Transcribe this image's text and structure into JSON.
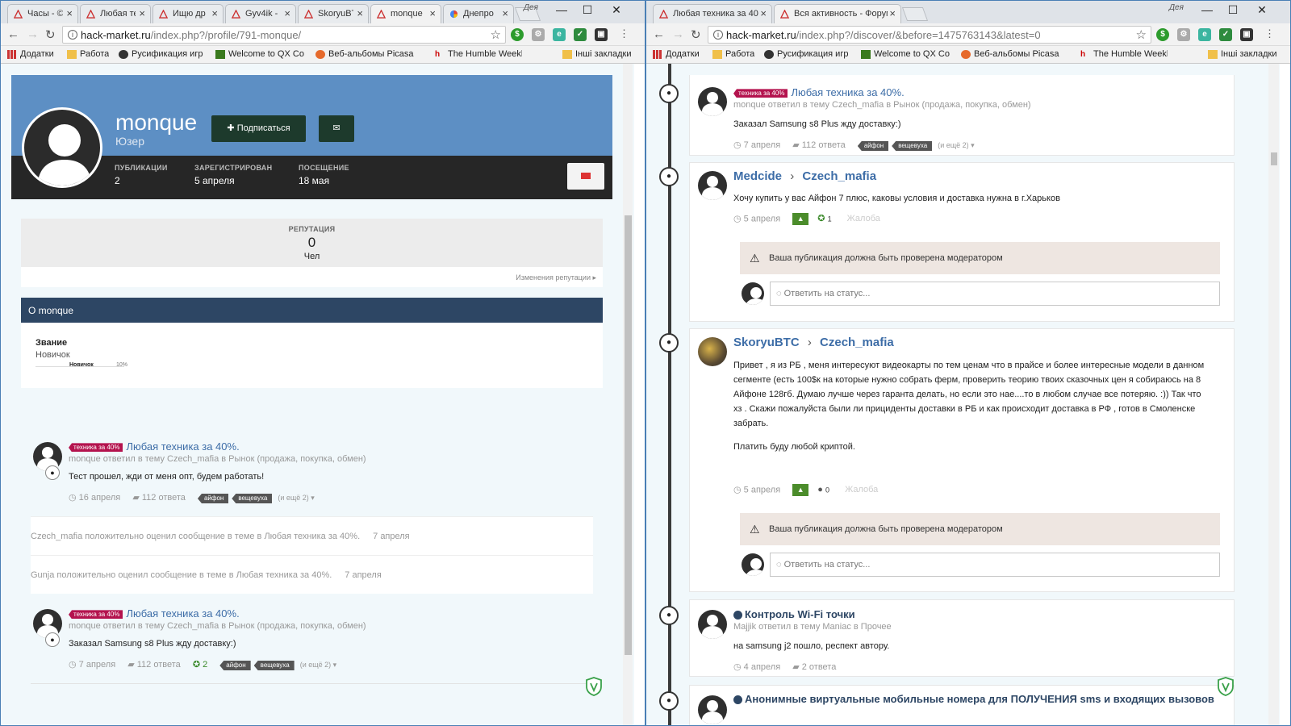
{
  "left": {
    "tabs": [
      {
        "label": "Часы - ©"
      },
      {
        "label": "Любая те"
      },
      {
        "label": "Ищю др"
      },
      {
        "label": "Gyv4ik -"
      },
      {
        "label": "SkoryuBT"
      },
      {
        "label": "monque"
      },
      {
        "label": "Днепро"
      }
    ],
    "profile_name": "Дея",
    "url_host": "hack-market.ru",
    "url_path": "/index.php?/profile/791-monque/",
    "bookmarks": [
      "Додатки",
      "Работа",
      "Русификация игр в",
      "Welcome to QX Cor",
      "Веб-альбомы Picasa",
      "The Humble Weekly",
      "Інші закладки"
    ],
    "profile": {
      "name": "monque",
      "rank": "Юзер",
      "subscribe_label": "Подписаться",
      "stats": [
        {
          "key": "ПУБЛИКАЦИИ",
          "value": "2"
        },
        {
          "key": "ЗАРЕГИСТРИРОВАН",
          "value": "5 апреля"
        },
        {
          "key": "ПОСЕЩЕНИЕ",
          "value": "18 мая"
        }
      ]
    },
    "reputation": {
      "label": "РЕПУТАЦИЯ",
      "value": "0",
      "sub": "Чел",
      "link": "Изменения репутации ▸"
    },
    "about": {
      "title": "О monque",
      "rank_label": "Звание",
      "rank_value": "Новичок",
      "progress_label": "Новичок",
      "progress_pct": "10%"
    },
    "feed": [
      {
        "tag": "техника за 40%",
        "title": "Любая техника за 40%.",
        "meta": "monque ответил в тему Czech_mafia в Рынок (продажа, покупка, обмен)",
        "body": "Тест прошел, жди от меня опт, будем работать!",
        "date": "16 апреля",
        "replies": "112 ответа",
        "chips": [
          "айфон",
          "вещевуха"
        ],
        "more": "(и ещё 2) ▾"
      },
      {
        "tag": "техника за 40%",
        "title": "Любая техника за 40%.",
        "meta": "monque ответил в тему Czech_mafia в Рынок (продажа, покупка, обмен)",
        "body": "Заказал Samsung s8 Plus жду доставку:)",
        "date": "7 апреля",
        "replies": "112 ответа",
        "rep": "2",
        "chips": [
          "айфон",
          "вещевуха"
        ],
        "more": "(и ещё 2) ▾"
      }
    ],
    "activity": [
      {
        "text": "Czech_mafia положительно оценил сообщение в теме в Любая техника за 40%.",
        "date": "7 апреля"
      },
      {
        "text": "Gunja положительно оценил сообщение в теме в Любая техника за 40%.",
        "date": "7 апреля"
      }
    ]
  },
  "right": {
    "tabs": [
      {
        "label": "Любая техника за 40%."
      },
      {
        "label": "Вся активность - Форум"
      }
    ],
    "profile_name": "Дея",
    "url_host": "hack-market.ru",
    "url_path": "/index.php?/discover/&before=1475763143&latest=0",
    "bookmarks": [
      "Додатки",
      "Работа",
      "Русификация игр в",
      "Welcome to QX Cor",
      "Веб-альбомы Picasa",
      "The Humble Weekly",
      "Інші закладки"
    ],
    "items": [
      {
        "tag": "техника за 40%",
        "title": "Любая техника за 40%.",
        "meta": "monque ответил в тему Czech_mafia в Рынок (продажа, покупка, обмен)",
        "body": "Заказал Samsung s8 Plus жду доставку:)",
        "date": "7 апреля",
        "replies": "112 ответа",
        "chips": [
          "айфон",
          "вещевуха"
        ],
        "more": "(и ещё 2) ▾"
      },
      {
        "author": "Medcide",
        "target": "Czech_mafia",
        "body": "Хочу купить у вас Айфон 7 плюс, каковы условия и доставка нужна в г.Харьков",
        "date": "5 апреля",
        "rep": "1",
        "report": "Жалоба",
        "warning": "Ваша публикация должна быть проверена модератором",
        "reply_placeholder": "Ответить на статус..."
      },
      {
        "author": "SkoryuBTC",
        "target": "Czech_mafia",
        "body_lines": [
          "Привет , я из РБ , меня интересуют видеокарты по тем ценам что в прайсе и более интересные модели в данном",
          "сегменте (есть 100$к на которые нужно собрать ферм, проверить теорию твоих сказочных цен я собираюсь на 8",
          "Айфоне 128гб. Думаю лучше через гаранта делать, но если это нае....то в любом случае все потеряю. :)) Так что",
          "хз . Скажи пожалуйста были ли прициденты доставки в РБ и как происходит доставка в РФ , готов в Смоленске",
          "забрать."
        ],
        "body2": "Платить буду любой криптой.",
        "date": "5 апреля",
        "rep": "0",
        "report": "Жалоба",
        "warning": "Ваша публикация должна быть проверена модератором",
        "reply_placeholder": "Ответить на статус..."
      },
      {
        "title": "Контроль Wi-Fi точки",
        "meta": "Majjik ответил в тему Maniac в Прочее",
        "body": "на samsung j2 пошло, респект автору.",
        "date": "4 апреля",
        "replies": "2 ответа"
      },
      {
        "title": "Анонимные виртуальные мобильные номера для ПОЛУЧЕНИЯ sms и входящих вызовов"
      }
    ]
  },
  "colors": {
    "cover": "#5d8fc4",
    "profile_bar": "#262626",
    "link": "#3d6da7",
    "tag": "#b4134e",
    "about_header": "#2d4664",
    "upvote": "#4b8c2b"
  }
}
